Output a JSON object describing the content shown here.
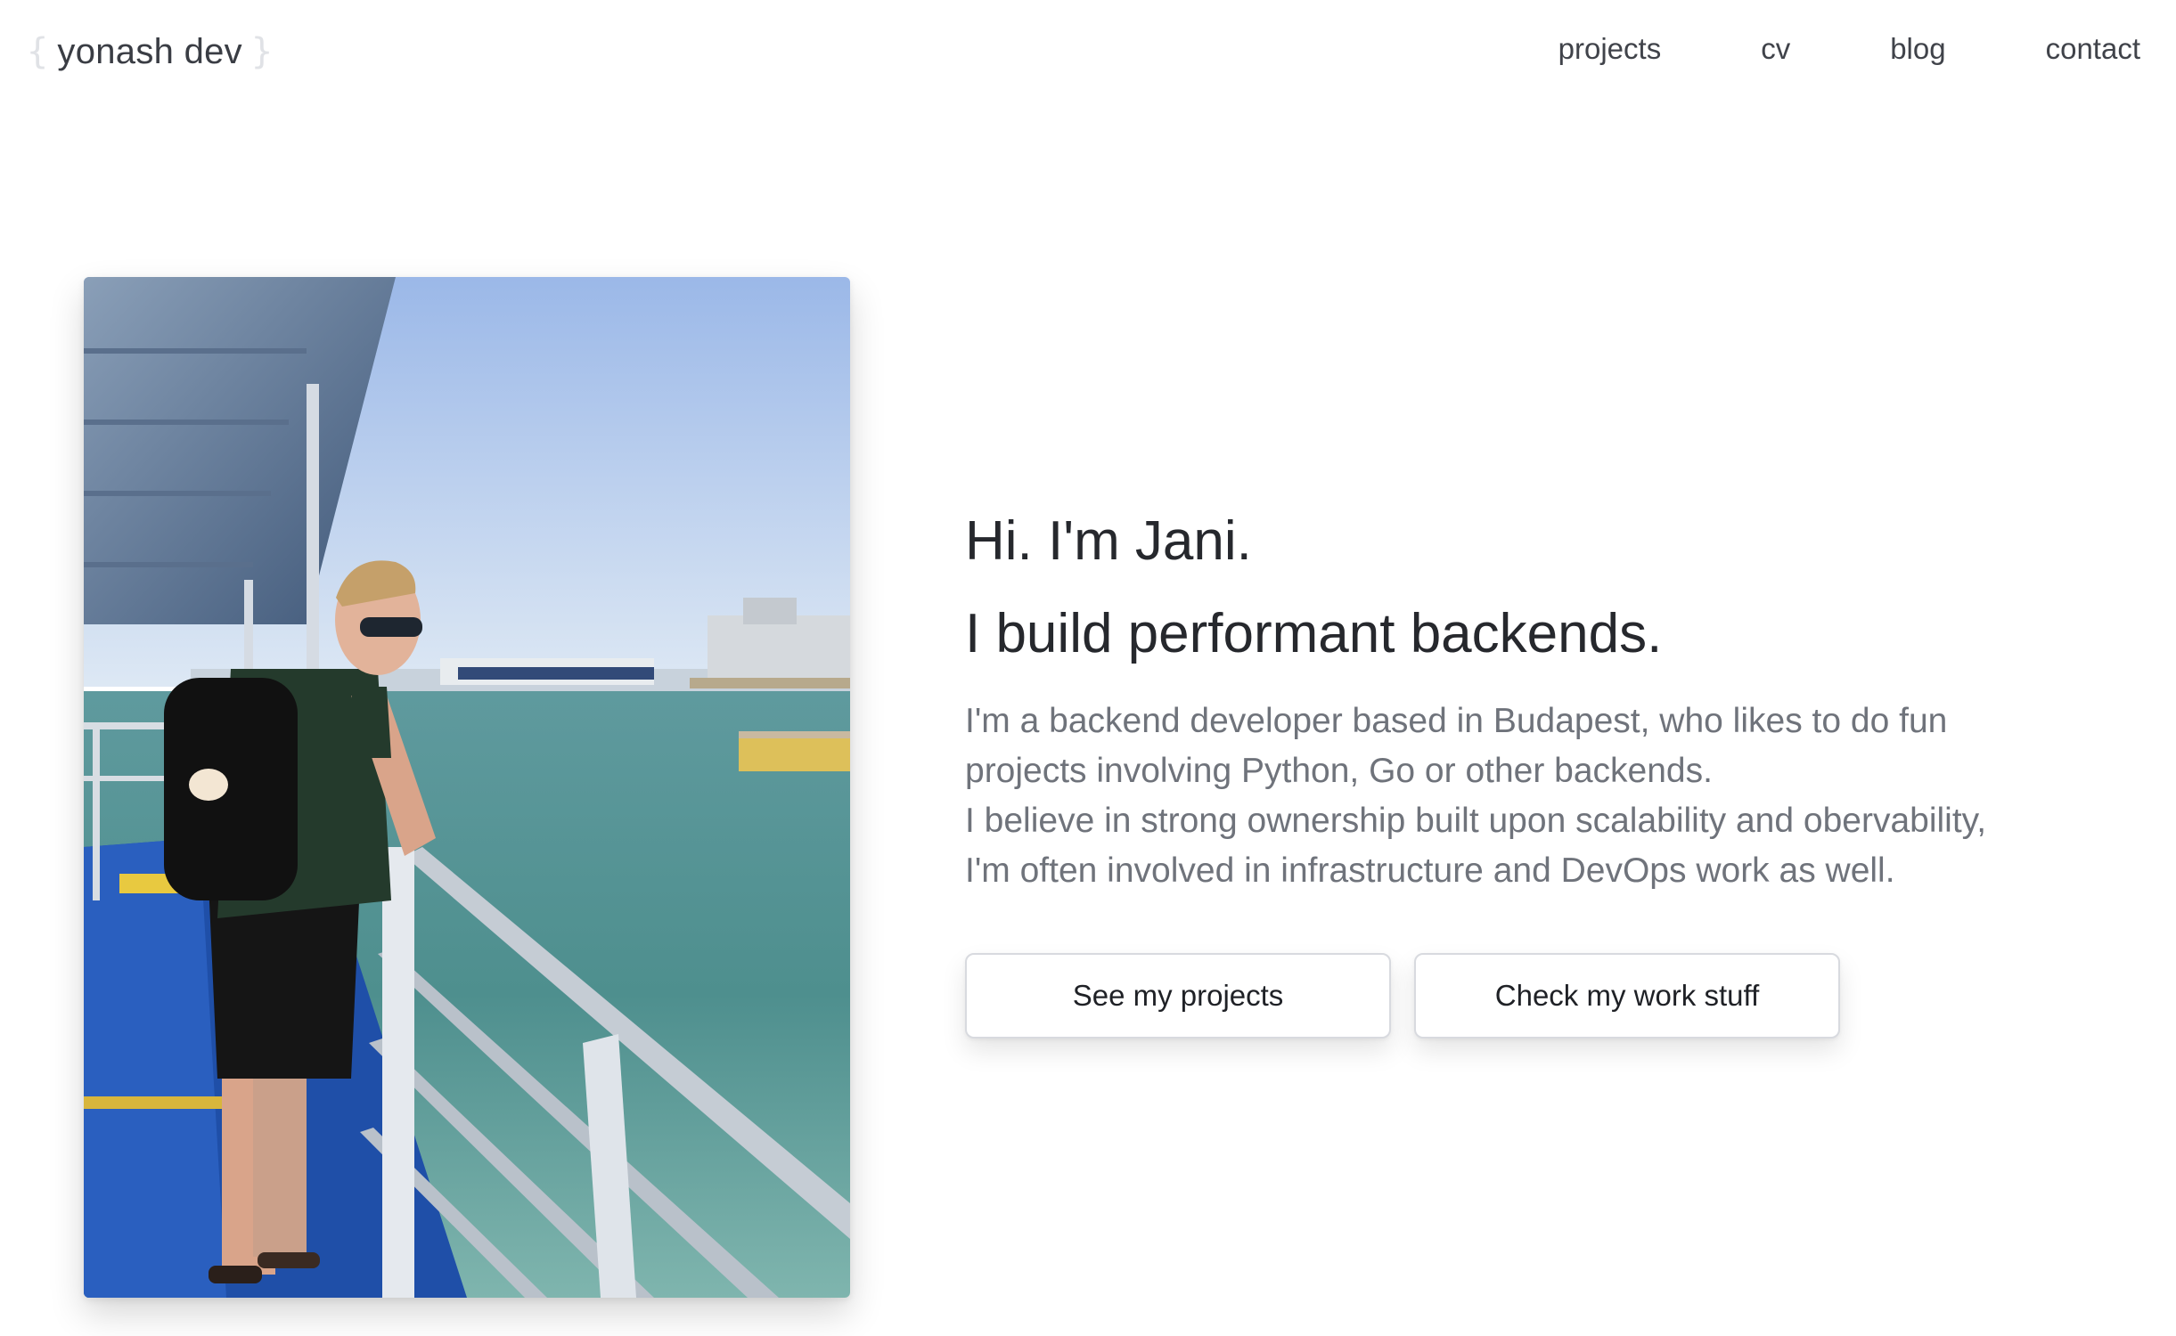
{
  "header": {
    "brand_open": "{",
    "brand_name": "yonash dev",
    "brand_close": "}",
    "nav": [
      {
        "label": "projects"
      },
      {
        "label": "cv"
      },
      {
        "label": "blog"
      },
      {
        "label": "contact"
      }
    ]
  },
  "hero": {
    "greeting": "Hi. I'm Jani.",
    "tagline": "I build performant backends.",
    "bio_lines": [
      "I'm a backend developer based in Budapest, who likes to do fun",
      "projects involving Python, Go or other backends.",
      "I believe in strong ownership built upon scalability and obervability,",
      "I'm often involved in infrastructure and DevOps work as well."
    ],
    "buttons": {
      "projects_label": "See my projects",
      "work_label": "Check my work stuff"
    }
  },
  "colors": {
    "text_dark": "#26282d",
    "text_muted": "#6f737b",
    "brace": "#e0e2e6",
    "button_border": "#d8dadf"
  }
}
